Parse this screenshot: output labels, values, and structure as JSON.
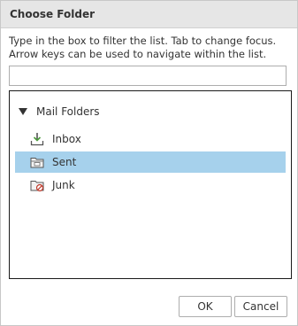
{
  "dialog": {
    "title": "Choose Folder",
    "instructions": "Type in the box to filter the list. Tab to change focus. Arrow keys can be used to navigate within the list.",
    "filter": {
      "value": "",
      "placeholder": ""
    }
  },
  "tree": {
    "root_label": "Mail Folders",
    "items": [
      {
        "label": "Inbox",
        "icon": "inbox-icon",
        "selected": false
      },
      {
        "label": "Sent",
        "icon": "sent-folder-icon",
        "selected": true
      },
      {
        "label": "Junk",
        "icon": "junk-folder-icon",
        "selected": false
      }
    ]
  },
  "buttons": {
    "ok": "OK",
    "cancel": "Cancel"
  },
  "colors": {
    "selection": "#a6d1ec",
    "titlebar": "#e6e6e6"
  }
}
